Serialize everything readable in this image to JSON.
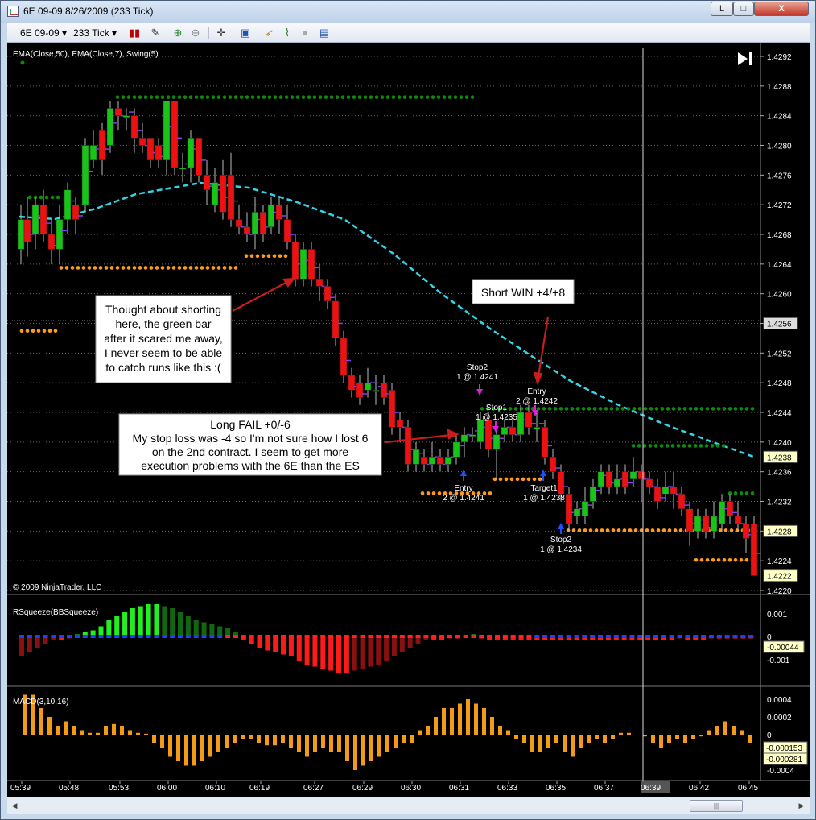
{
  "window": {
    "title": "6E 09-09  8/26/2009 (233 Tick)",
    "buttons": {
      "minimize": "L",
      "maximize": "□",
      "close": "X"
    }
  },
  "toolbar": {
    "instrument": "6E 09-09",
    "interval": "233 Tick",
    "icons": [
      "candlestick-icon",
      "pencil-icon",
      "zoom-in-icon",
      "zoom-out-icon",
      "crosshair-icon",
      "properties-icon",
      "strategy-icon",
      "indicator-icon",
      "globe-icon",
      "data-box-icon"
    ]
  },
  "chart": {
    "indicator_label": "EMA(Close,50), EMA(Close,7), Swing(5)",
    "copyright": "© 2009 NinjaTrader, LLC",
    "price_ticks": [
      "1.4292",
      "1.4288",
      "1.4284",
      "1.4280",
      "1.4276",
      "1.4272",
      "1.4268",
      "1.4264",
      "1.4260",
      "1.4256",
      "1.4252",
      "1.4248",
      "1.4244",
      "1.4240",
      "1.4236",
      "1.4232",
      "1.4228",
      "1.4224",
      "1.4220"
    ],
    "price_markers": [
      "1.4256",
      "1.4238",
      "1.4228",
      "1.4222"
    ],
    "time_ticks": [
      "05:39",
      "05:48",
      "05:53",
      "06:00",
      "06:10",
      "06:19",
      "06:27",
      "06:29",
      "06:30",
      "06:31",
      "06:33",
      "06:35",
      "06:37",
      "06:39",
      "06:42",
      "06:45"
    ],
    "crosshair_time": "06:39",
    "annotations": {
      "shorting_note": [
        "Thought about shorting",
        "here, the green bar",
        "after it scared me away,",
        "I never seem to be able",
        "to catch runs like this :("
      ],
      "long_fail": [
        "Long FAIL +0/-6",
        "My stop loss was -4 so I'm not sure how I lost 6",
        "on the 2nd contract.  I seem to get more",
        "execution problems with the 6E than the ES"
      ],
      "short_win": "Short WIN +4/+8"
    },
    "trade_labels": [
      {
        "name": "Stop2",
        "detail": "1 @ 1.4241"
      },
      {
        "name": "Stop1",
        "detail": "1 @ 1.4235"
      },
      {
        "name": "Entry",
        "detail": "2 @ 1.4242"
      },
      {
        "name": "Entry",
        "detail": "2 @ 1.4241"
      },
      {
        "name": "Target1",
        "detail": "1 @ 1.4238"
      },
      {
        "name": "Stop2",
        "detail": "1 @ 1.4234"
      }
    ]
  },
  "rsqueeze": {
    "label": "RSqueeze(BBSqueeze)",
    "ticks": [
      "0.001",
      "0",
      "-0.001"
    ],
    "marker": "-0.00044"
  },
  "macd": {
    "label": "MACD(3,10,16)",
    "ticks": [
      "0.0004",
      "0.0002",
      "0",
      "-0.0002",
      "-0.0004"
    ],
    "markers": [
      "-0.000153",
      "-0.000281"
    ]
  },
  "colors": {
    "up_candle": "#19c419",
    "down_candle": "#ee1111",
    "ema50": "#33d4e8",
    "ema7": "#8a3cf0",
    "swing_high": "#0e8a0e",
    "swing_low": "#ff9b1a",
    "macd_bar": "#f39a16"
  }
}
